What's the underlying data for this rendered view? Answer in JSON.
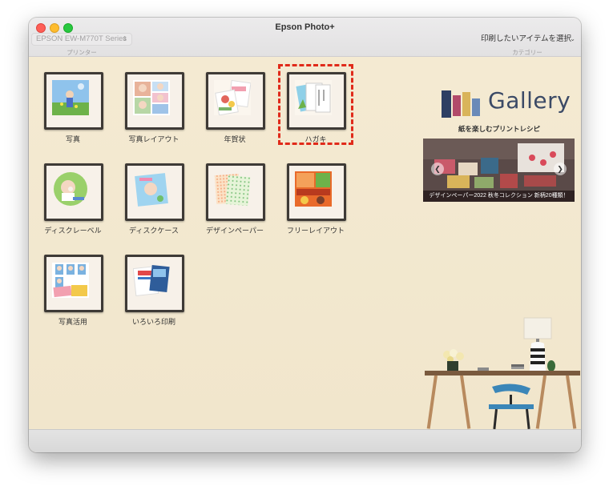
{
  "window": {
    "title": "Epson Photo+"
  },
  "printer": {
    "value": "EPSON EW-M770T Series",
    "caption": "プリンター"
  },
  "category": {
    "value": "印刷したいアイテムを選択",
    "caption": "カテゴリー"
  },
  "items": [
    {
      "label": "写真"
    },
    {
      "label": "写真レイアウト"
    },
    {
      "label": "年賀状"
    },
    {
      "label": "ハガキ"
    },
    {
      "label": "ディスクレーベル"
    },
    {
      "label": "ディスクケース"
    },
    {
      "label": "デザインペーパー"
    },
    {
      "label": "フリーレイアウト"
    },
    {
      "label": "写真活用"
    },
    {
      "label": "いろいろ印刷"
    }
  ],
  "selected_item": "ハガキ",
  "gallery": {
    "logo_text": "Gallery",
    "tagline": "紙を楽しむプリントレシピ",
    "banner_caption": "デザインペーパー2022 秋冬コレクション 新柄20種類！"
  },
  "colors": {
    "selection": "#e02a1a",
    "frame": "#3e3a36",
    "background": "#f3ead4"
  }
}
